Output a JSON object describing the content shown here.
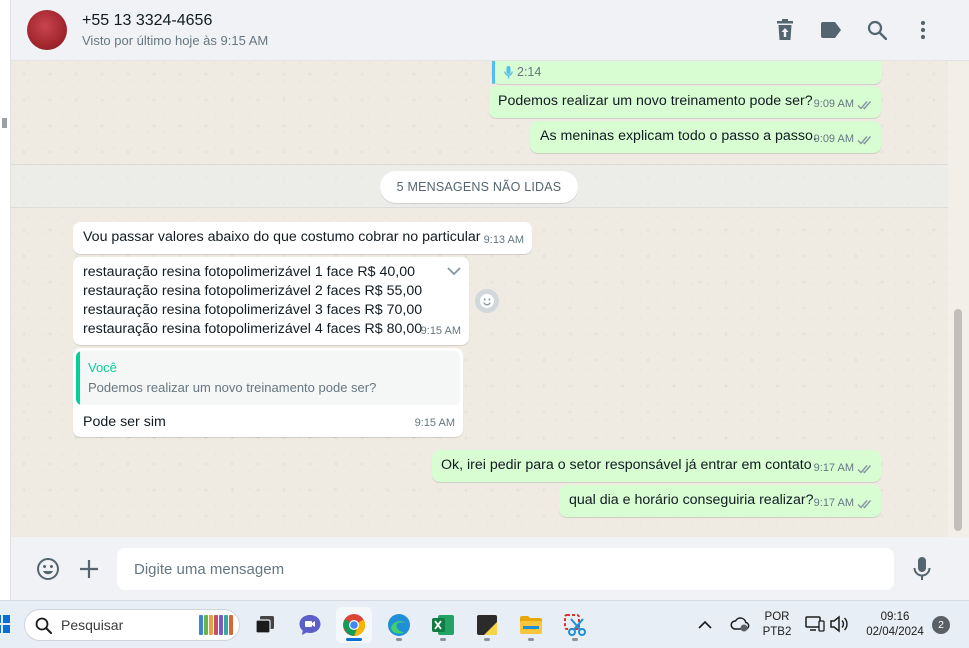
{
  "header": {
    "contact_name": "+55 13 3324-4656",
    "contact_status": "Visto por último hoje às 9:15 AM"
  },
  "messages": {
    "audio_duration": "2:14",
    "m1": {
      "text": "Podemos realizar um novo treinamento pode ser?",
      "time": "9:09 AM"
    },
    "m2": {
      "text": "As meninas explicam todo o passo a passo.",
      "time": "9:09 AM"
    },
    "unread_label": "5 MENSAGENS NÃO LIDAS",
    "m3": {
      "text": "Vou passar valores abaixo do que costumo cobrar no particular",
      "time": "9:13 AM"
    },
    "m4": {
      "lines": [
        "restauração resina fotopolimerizável 1 face R$ 40,00",
        "restauração resina fotopolimerizável 2 faces R$ 55,00",
        "restauração resina fotopolimerizável 3 faces R$ 70,00",
        "restauração resina fotopolimerizável 4 faces R$ 80,00"
      ],
      "time": "9:15 AM"
    },
    "m5": {
      "quote_author": "Você",
      "quote_text": "Podemos realizar um novo treinamento pode ser?",
      "text": "Pode ser sim",
      "time": "9:15 AM"
    },
    "m6": {
      "text": "Ok, irei pedir para o setor responsável já entrar em contato",
      "time": "9:17 AM"
    },
    "m7": {
      "text": "qual dia e horário conseguiria realizar?",
      "time": "9:17 AM"
    }
  },
  "composer": {
    "placeholder": "Digite uma mensagem"
  },
  "taskbar": {
    "search_label": "Pesquisar",
    "lang_line1": "POR",
    "lang_line2": "PTB2",
    "time": "09:16",
    "date": "02/04/2024",
    "notification_count": "2"
  },
  "colors": {
    "outgoing_bubble": "#d9fdd3",
    "incoming_bubble": "#ffffff",
    "accent": "#06cf9c"
  }
}
